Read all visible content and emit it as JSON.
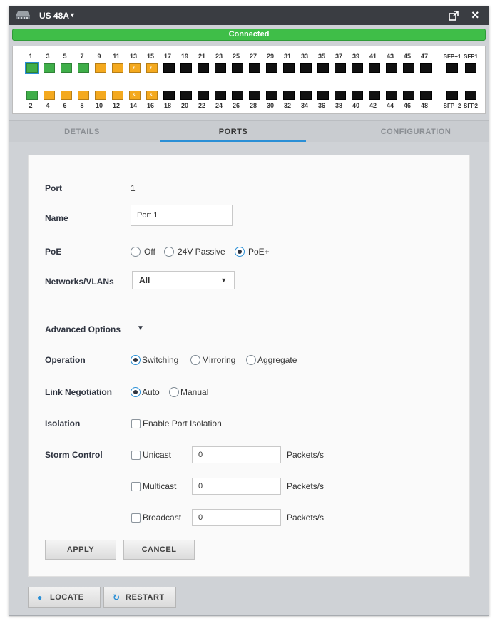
{
  "window": {
    "device_name": "US 48A",
    "title_caret": "▼",
    "close_glyph": "×",
    "status": "Connected"
  },
  "ports": {
    "top_numbers": [
      "1",
      "3",
      "5",
      "7",
      "9",
      "11",
      "13",
      "15",
      "17",
      "19",
      "21",
      "23",
      "25",
      "27",
      "29",
      "31",
      "33",
      "35",
      "37",
      "39",
      "41",
      "43",
      "45",
      "47"
    ],
    "bottom_numbers": [
      "2",
      "4",
      "6",
      "8",
      "10",
      "12",
      "14",
      "16",
      "18",
      "20",
      "22",
      "24",
      "26",
      "28",
      "30",
      "32",
      "34",
      "36",
      "38",
      "40",
      "42",
      "44",
      "46",
      "48"
    ],
    "top_states": [
      "green",
      "green",
      "green",
      "green",
      "orange",
      "orange",
      "orange-poe",
      "orange-poe",
      "black",
      "black",
      "black",
      "black",
      "black",
      "black",
      "black",
      "black",
      "black",
      "black",
      "black",
      "black",
      "black",
      "black",
      "black",
      "black"
    ],
    "bottom_states": [
      "green",
      "orange",
      "orange",
      "orange",
      "orange",
      "orange",
      "orange-poe",
      "orange-poe",
      "black",
      "black",
      "black",
      "black",
      "black",
      "black",
      "black",
      "black",
      "black",
      "black",
      "black",
      "black",
      "black",
      "black",
      "black",
      "black"
    ],
    "sfp_top": [
      "SFP+1",
      "SFP1"
    ],
    "sfp_bottom": [
      "SFP+2",
      "SFP2"
    ],
    "poe_symbol": "⚡",
    "selected_port": "1",
    "colors": {
      "green": "#3fae49",
      "orange": "#f4a91e",
      "black": "#111111",
      "selected": "#2a8fd6"
    }
  },
  "tabs": [
    "DETAILS",
    "PORTS",
    "CONFIGURATION"
  ],
  "active_tab": "PORTS",
  "form": {
    "port_label": "Port",
    "port_value": "1",
    "name_label": "Name",
    "name_value": "Port 1",
    "poe_label": "PoE",
    "poe_options": [
      "Off",
      "24V Passive",
      "PoE+"
    ],
    "poe_selected": "PoE+",
    "networks_label": "Networks/VLANs",
    "networks_value": "All",
    "advanced_label": "Advanced Options",
    "operation_label": "Operation",
    "operation_options": [
      "Switching",
      "Mirroring",
      "Aggregate"
    ],
    "operation_selected": "Switching",
    "link_label": "Link Negotiation",
    "link_options": [
      "Auto",
      "Manual"
    ],
    "link_selected": "Auto",
    "isolation_label": "Isolation",
    "isolation_option": "Enable Port Isolation",
    "storm_label": "Storm Control",
    "storm_rows": [
      {
        "name": "Unicast",
        "value": "0",
        "unit": "Packets/s"
      },
      {
        "name": "Multicast",
        "value": "0",
        "unit": "Packets/s"
      },
      {
        "name": "Broadcast",
        "value": "0",
        "unit": "Packets/s"
      }
    ],
    "apply_label": "APPLY",
    "cancel_label": "CANCEL"
  },
  "footer": {
    "locate_label": "LOCATE",
    "restart_label": "RESTART"
  },
  "accent_color": "#2a8fd6",
  "status_color": "#3fbe48"
}
